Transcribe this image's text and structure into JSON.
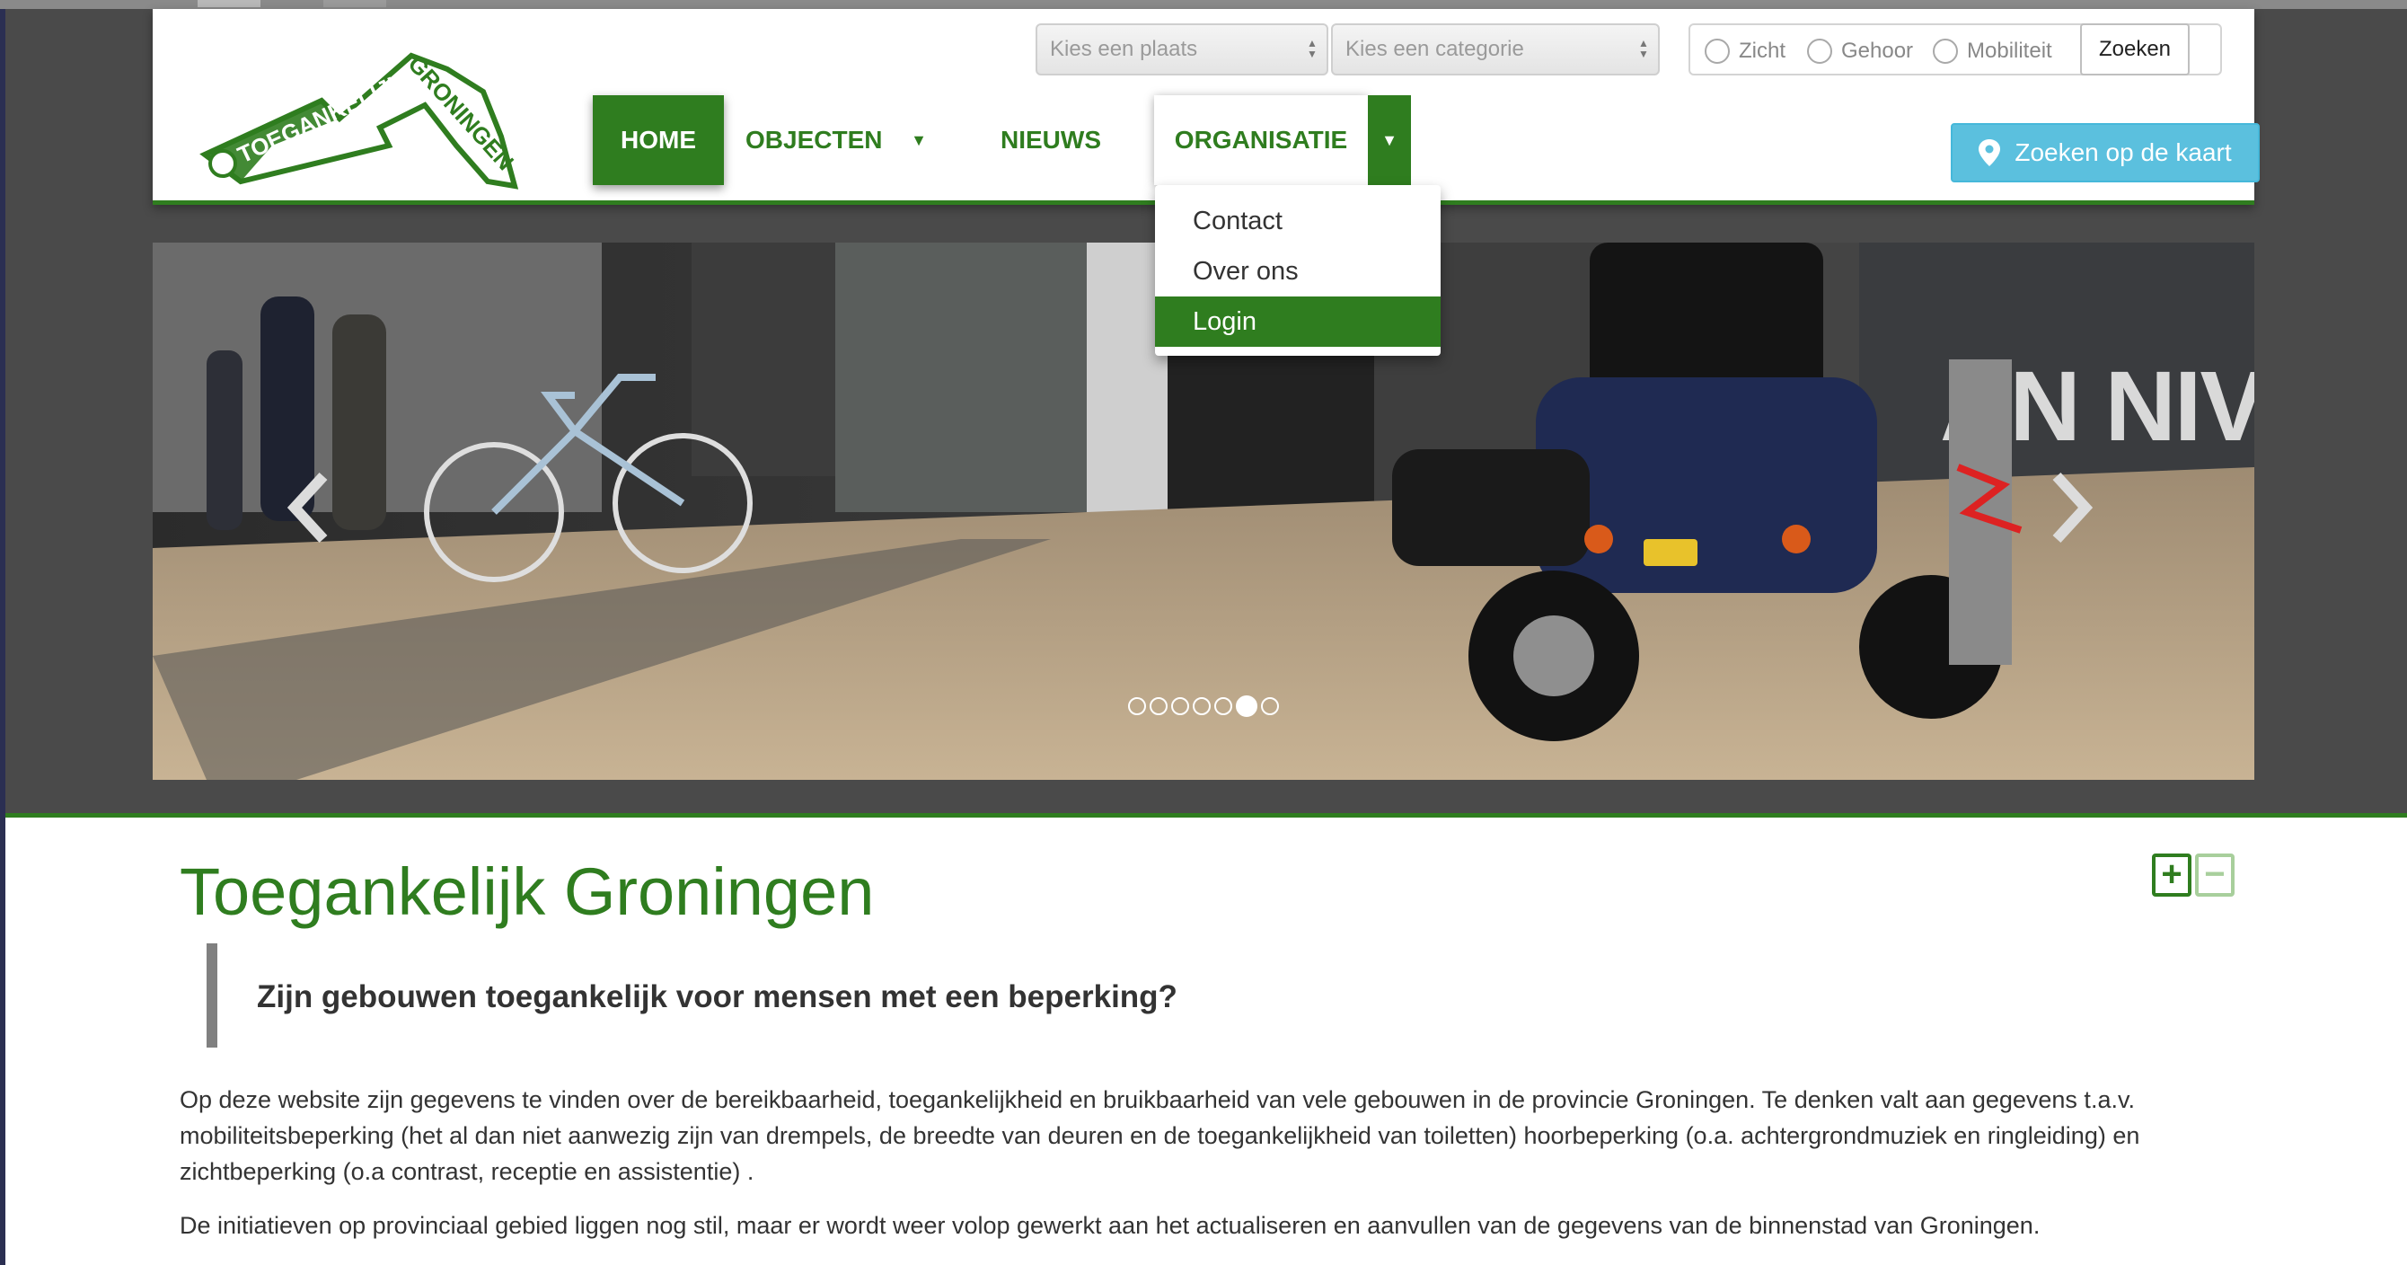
{
  "colors": {
    "brand_green": "#2f7d1f",
    "map_button_blue": "#5bc0de",
    "text_dark": "#333333"
  },
  "logo": {
    "text_left": "TOEGANKELIJK",
    "text_right": "GRONINGEN"
  },
  "search": {
    "place_placeholder": "Kies een plaats",
    "category_placeholder": "Kies een categorie",
    "radios": [
      "Zicht",
      "Gehoor",
      "Mobiliteit"
    ],
    "submit_label": "Zoeken"
  },
  "nav": {
    "home": "HOME",
    "objecten": "OBJECTEN",
    "nieuws": "NIEUWS",
    "organisatie": "ORGANISATIE",
    "map_button": "Zoeken op de kaart",
    "map_button_icon": "map-marker-icon"
  },
  "dropdown": {
    "items": [
      "Contact",
      "Over ons",
      "Login"
    ],
    "active_index": 2
  },
  "carousel": {
    "slide_count": 7,
    "active_slide": 6,
    "storefront_text": "AN NIVERS"
  },
  "content": {
    "title": "Toegankelijk Groningen",
    "zoom_in": "+",
    "zoom_out": "−",
    "lead": "Zijn gebouwen toegankelijk voor mensen met een beperking?",
    "paragraph_1": "Op deze website zijn gegevens te vinden over de bereikbaarheid, toegankelijkheid en bruikbaarheid van vele gebouwen in de provincie Groningen. Te denken valt aan gegevens t.a.v. mobiliteitsbeperking (het al dan niet aanwezig zijn van drempels, de breedte van deuren en de toegankelijkheid van toiletten) hoorbeperking (o.a. achtergrondmuziek en ringleiding) en zichtbeperking (o.a contrast, receptie en assistentie) .",
    "paragraph_2": "De initiatieven op provinciaal gebied liggen nog stil, maar er wordt weer volop gewerkt aan het actualiseren en aanvullen van de gegevens van de binnenstad van Groningen."
  }
}
